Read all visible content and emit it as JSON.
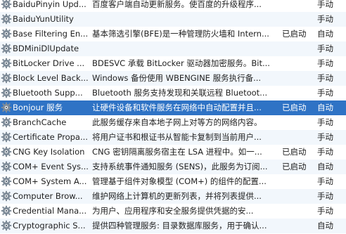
{
  "services": [
    {
      "name": "BaiduPinyin Upd...",
      "description": "百度客户端自动更新服务。使百度的升级程序...",
      "status": "",
      "startup": "手动"
    },
    {
      "name": "BaiduYunUtility",
      "description": "",
      "status": "",
      "startup": "手动"
    },
    {
      "name": "Base Filtering En...",
      "description": "基本筛选引擎(BFE)是一种管理防火墙和 Intern...",
      "status": "已启动",
      "startup": "自动"
    },
    {
      "name": "BDMiniDlUpdate",
      "description": "",
      "status": "",
      "startup": "手动"
    },
    {
      "name": "BitLocker Drive ...",
      "description": "BDESVC 承载 BitLocker 驱动器加密服务。Bit...",
      "status": "",
      "startup": "手动"
    },
    {
      "name": "Block Level Back...",
      "description": "Windows 备份使用 WBENGINE 服务执行备...",
      "status": "",
      "startup": "手动"
    },
    {
      "name": "Bluetooth Supp...",
      "description": "Bluetooth 服务支持发现和关联远程 Bluetoot...",
      "status": "",
      "startup": "手动"
    },
    {
      "name": "Bonjour 服务",
      "description": "让硬件设备和软件服务在网络中自动配置并且...",
      "status": "已启动",
      "startup": "自动",
      "selected": true
    },
    {
      "name": "BranchCache",
      "description": "此服务缓存来自本地子网上对等方的网络内容。",
      "status": "",
      "startup": "手动"
    },
    {
      "name": "Certificate Propa...",
      "description": "将用户证书和根证书从智能卡复制到当前用户...",
      "status": "",
      "startup": "手动"
    },
    {
      "name": "CNG Key Isolation",
      "description": "CNG 密钥隔离服务宿主在 LSA 进程中。如一...",
      "status": "已启动",
      "startup": "手动"
    },
    {
      "name": "COM+ Event Sys...",
      "description": "支持系统事件通知服务 (SENS)，此服务为订阅...",
      "status": "已启动",
      "startup": "自动"
    },
    {
      "name": "COM+ System A...",
      "description": "管理基于组件对象模型 (COM+) 的组件的配置...",
      "status": "",
      "startup": "手动"
    },
    {
      "name": "Computer Brow...",
      "description": "维护网络上计算机的更新列表，并将列表提供...",
      "status": "",
      "startup": "手动"
    },
    {
      "name": "Credential Mana...",
      "description": "为用户、应用程序和安全服务提供凭据的安...",
      "status": "",
      "startup": "手动"
    },
    {
      "name": "Cryptographic S...",
      "description": "提供四种管理服务: 目录数据库服务，用于确认...",
      "status": "",
      "startup": "自动"
    }
  ],
  "colors": {
    "selected_bg": "#2f73c5",
    "alt_row_bg": "#f2f7fc",
    "icon_gear": "#7f8c99"
  },
  "icon": "gear-service-icon"
}
